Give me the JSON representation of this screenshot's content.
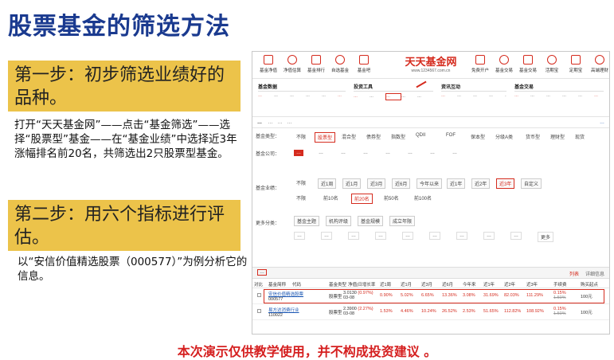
{
  "slide": {
    "title": "股票基金的筛选方法",
    "step1": {
      "heading": "第一步：初步筛选业绩好的品种。",
      "body": "打开“天天基金网”——点击“基金筛选”——选择“股票型”基金——在“基金业绩”中选择近3年涨幅排名前20名，共筛选出2只股票型基金。"
    },
    "step2": {
      "heading": "第二步：用六个指标进行评估。",
      "body": "以“安信价值精选股票（000577）”为例分析它的信息。"
    },
    "disclaimer": "本次演示仅供教学使用，并不构成投资建议 。"
  },
  "colors": {
    "title": "#1a3a8f",
    "step_box": "#ecc34a",
    "accent_red": "#d52b1e",
    "link_blue": "#1a56b3"
  },
  "screenshot": {
    "brand": {
      "name": "天天基金网",
      "url": "www.1234567.com.cn"
    },
    "nav_left": [
      {
        "label": "基金净值",
        "icon": "chart-icon"
      },
      {
        "label": "净值估算",
        "icon": "trend-icon"
      },
      {
        "label": "基金排行",
        "icon": "bar-chart-icon"
      },
      {
        "label": "自选基金",
        "icon": "star-icon"
      },
      {
        "label": "基金吧",
        "icon": "chat-icon"
      }
    ],
    "nav_right": [
      {
        "label": "免费开户",
        "icon": "user-icon"
      },
      {
        "label": "基金交易",
        "icon": "yuan-icon"
      },
      {
        "label": "基金交易",
        "icon": "coin-icon"
      },
      {
        "label": "活期宝",
        "icon": "wallet-icon"
      },
      {
        "label": "定期宝",
        "icon": "calendar-icon"
      },
      {
        "label": "高端理财",
        "icon": "briefcase-icon"
      }
    ],
    "submenu": [
      {
        "heading": "基金数据",
        "items": [
          "…",
          "…",
          "…",
          "…",
          "…",
          "…",
          "…",
          "…",
          "…",
          "…",
          "…",
          "…"
        ]
      },
      {
        "heading": "投资工具",
        "items": [
          "…",
          "…",
          "…",
          "…",
          "…",
          "…",
          "…",
          "…",
          "…",
          "…",
          "…",
          "…"
        ]
      },
      {
        "heading": "资讯互动",
        "items": [
          "…",
          "…",
          "…",
          "…",
          "…",
          "…",
          "…",
          "…",
          "…",
          "…",
          "…",
          "…"
        ]
      },
      {
        "heading": "基金交易",
        "items": [
          "…",
          "…",
          "…",
          "…",
          "…",
          "…",
          "…",
          "…",
          "…",
          "…",
          "…",
          "…"
        ]
      }
    ],
    "crumbs": {
      "label": "…",
      "chips": [
        "…",
        "…",
        "…"
      ],
      "right": "…"
    },
    "filters": {
      "fund_type": {
        "label": "基金类型：",
        "options": [
          "不限",
          "股票型",
          "混合型",
          "债券型",
          "指数型",
          "QDII",
          "FOF",
          "保本型",
          "分级A类",
          "货币型",
          "理财型",
          "现货"
        ]
      },
      "fund_company": {
        "label": "基金公司：",
        "options": [
          "…",
          "…",
          "…",
          "…",
          "…",
          "…",
          "…",
          "…"
        ]
      },
      "fund_performance": {
        "label": "基金业绩：",
        "periods": [
          "不限",
          "近1周",
          "近1月",
          "近3月",
          "近6月",
          "今年以来",
          "近1年",
          "近2年",
          "近3年",
          "自定义"
        ],
        "ranks": [
          "不限",
          "前10名",
          "前20名",
          "前50名",
          "前100名"
        ]
      },
      "more": {
        "label": "更多分类：",
        "options": [
          "基金主题",
          "机构评级",
          "基金规模",
          "成立年限"
        ],
        "tags": [
          "…",
          "…",
          "…",
          "…",
          "…",
          "…",
          "…",
          "…",
          "…"
        ],
        "more_link": "更多"
      }
    },
    "results": {
      "count_text": "…",
      "tabs": [
        "列表",
        "详细信息"
      ],
      "headers": [
        "对比",
        "基金简称",
        "代码",
        "基金类型",
        "净值|日增长率",
        "近1周",
        "近1月",
        "近3月",
        "近6月",
        "今年来",
        "近1年",
        "近2年",
        "近3年",
        "手续费",
        "购买起点"
      ],
      "rows": [
        {
          "name": "安信价值精选股票",
          "code": "000577",
          "type": "股票型",
          "nav": "3.0130",
          "daily": "(0.97%)",
          "date": "03-08",
          "returns": [
            "0.90%",
            "5.02%",
            "6.65%",
            "13.36%",
            "3.08%",
            "31.69%",
            "82.03%",
            "111.29%"
          ],
          "fee_now": "0.15%",
          "fee_orig": "1.50%",
          "min_buy": "100元"
        },
        {
          "name": "易方达消费行业",
          "code": "110022",
          "type": "股票型",
          "nav": "2.3900",
          "daily": "(2.27%)",
          "date": "03-08",
          "returns": [
            "1.53%",
            "4.46%",
            "10.24%",
            "26.52%",
            "2.53%",
            "51.65%",
            "112.82%",
            "108.92%"
          ],
          "fee_now": "0.15%",
          "fee_orig": "1.50%",
          "min_buy": "100元"
        }
      ]
    }
  }
}
